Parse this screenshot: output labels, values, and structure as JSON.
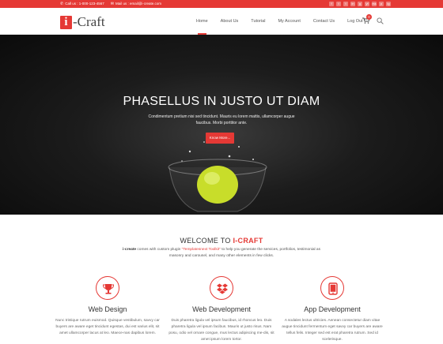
{
  "topbar": {
    "phone": "Call us : 1-000-123-4567",
    "email": "Mail us : email@i-create.com",
    "social": [
      "f",
      "t",
      "t",
      "in",
      "g",
      "yt",
      "rss",
      "p",
      "ig"
    ]
  },
  "header": {
    "logo_mark": "i",
    "logo_word": "-Craft",
    "nav": [
      "Home",
      "About Us",
      "Tutorial",
      "My Account",
      "Contact Us",
      "Log Out"
    ],
    "cart_count": "0"
  },
  "hero": {
    "title": "PHASELLUS IN JUSTO UT DIAM",
    "subtitle": "Condimentum pretium nisi sed tincidunt. Mauris eu lorem mattis, ullamcorper augue faucibus. Morbi porttitor ante.",
    "button": "Know More..."
  },
  "welcome": {
    "title_prefix": "WELCOME TO ",
    "title_accent": "I-CRAFT",
    "brand": "i-create",
    "text1": " comes with custom plugin ",
    "plugin": "\"Templatesnext Toolkit\"",
    "text2": " to help you generate the services, portfolios, testimonial as masonry and carousel, and many other elements in few clicks."
  },
  "services": [
    {
      "title": "Web Design",
      "icon": "trophy-icon",
      "desc": "Nunc tristique rutrum euismod. Quisque vestibulum, savvy car buyers are aware eget tincidunt egestas, dui est varius elit, sit amet ullamcorper lacus at leo. Maece-nas dapibus lorem."
    },
    {
      "title": "Web Development",
      "icon": "dropbox-icon",
      "desc": "Duis pharetra ligula vel ipsum faucibus, id rhoncus leo. Duis pharetra ligula vel ipsum facibus. Mauris ut justo risus. Nam posu, odio vel ornare congue, mus lectus adipiscing me-dis, sit amet ipsum lorem tortor."
    },
    {
      "title": "App Development",
      "icon": "tablet-icon",
      "desc": "A sodales lectus ultricies. Aenean consectetur diam vitae augue tincidunt fermentum eget savvy car buyers are aware tellus felis. Integer sed est erat pharetra rutrum. Sed id scelerisque."
    }
  ],
  "colors": {
    "accent": "#e53935",
    "text": "#555555",
    "hero_dark": "#111111"
  }
}
